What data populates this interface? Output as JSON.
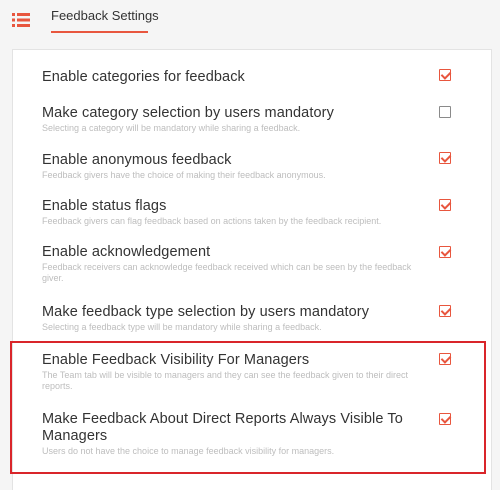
{
  "header": {
    "menu_icon": "list-icon",
    "tab_label": "Feedback Settings"
  },
  "colors": {
    "accent": "#e8563e",
    "highlight": "#d9252a"
  },
  "settings": [
    {
      "title": "Enable categories for feedback",
      "description": "",
      "checked": true
    },
    {
      "title": "Make category selection by users mandatory",
      "description": "Selecting a category will be mandatory while sharing a feedback.",
      "checked": false
    },
    {
      "title": "Enable anonymous feedback",
      "description": "Feedback givers have the choice of making their feedback anonymous.",
      "checked": true
    },
    {
      "title": "Enable status flags",
      "description": "Feedback givers can flag feedback based on actions taken by the feedback recipient.",
      "checked": true
    },
    {
      "title": "Enable acknowledgement",
      "description": "Feedback receivers can acknowledge feedback received which can be seen by the feedback giver.",
      "checked": true
    },
    {
      "title": "Make feedback type selection by users mandatory",
      "description": "Selecting a feedback type will be mandatory while sharing a feedback.",
      "checked": true
    },
    {
      "title": "Enable Feedback Visibility For Managers",
      "description": "The Team tab will be visible to managers and they can see the feedback given to their direct reports.",
      "checked": true
    },
    {
      "title": "Make Feedback About Direct Reports Always Visible To Managers",
      "description": "Users do not have the choice to manage feedback visibility for managers.",
      "checked": true
    }
  ]
}
